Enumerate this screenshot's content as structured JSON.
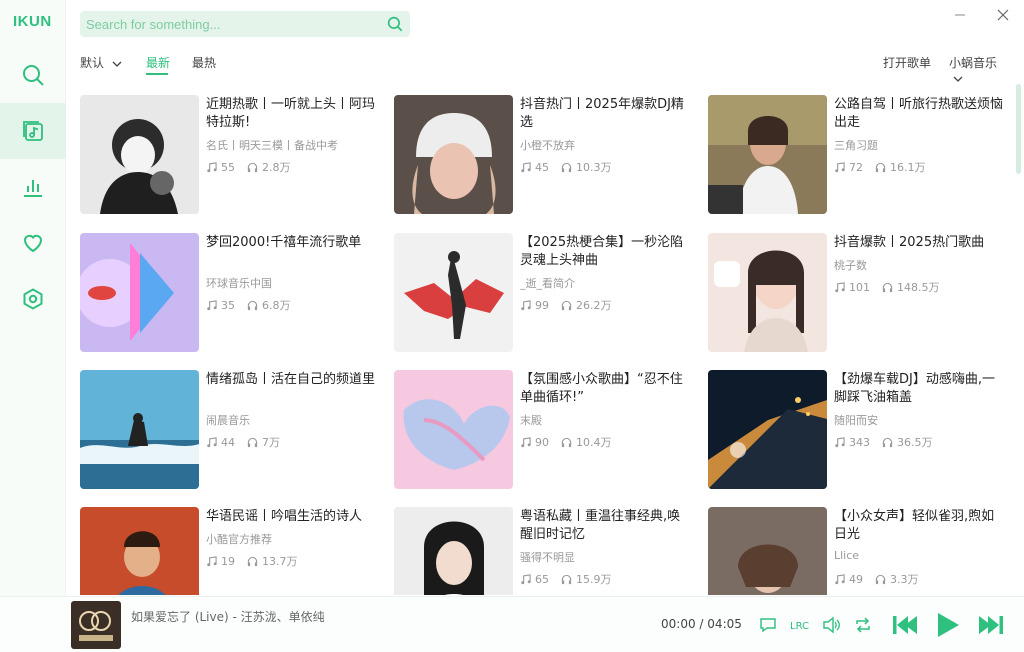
{
  "app": {
    "logo": "IKUN"
  },
  "search": {
    "placeholder": "Search for something..."
  },
  "colors": {
    "accent": "#2fbf7f",
    "accent_light": "#e4f4ea"
  },
  "sidebar": {
    "items": [
      {
        "name": "search",
        "icon": "search-icon",
        "active": false
      },
      {
        "name": "library",
        "icon": "music-library-icon",
        "active": true
      },
      {
        "name": "charts",
        "icon": "bar-chart-icon",
        "active": false
      },
      {
        "name": "favorites",
        "icon": "heart-icon",
        "active": false
      },
      {
        "name": "settings",
        "icon": "settings-icon",
        "active": false
      }
    ]
  },
  "filters": {
    "sort_label": "默认",
    "tab_new": "最新",
    "tab_hot": "最热",
    "open_playlist": "打开歌单",
    "source": "小蜗音乐"
  },
  "playlists": [
    {
      "title": "近期热歌丨一听就上头丨阿玛特拉斯!",
      "author": "名氏丨明天三模丨备战中考",
      "songs": "55",
      "plays": "2.8万"
    },
    {
      "title": "抖音热门丨2025年爆款DJ精选",
      "author": "小橙不放弃",
      "songs": "45",
      "plays": "10.3万"
    },
    {
      "title": "公路自驾丨听旅行热歌送烦恼出走",
      "author": "三角习题",
      "songs": "72",
      "plays": "16.1万"
    },
    {
      "title": "梦回2000!千禧年流行歌单",
      "author": "环球音乐中国",
      "songs": "35",
      "plays": "6.8万"
    },
    {
      "title": "【2025热梗合集】一秒沦陷灵魂上头神曲",
      "author": "_逝_看简介",
      "songs": "99",
      "plays": "26.2万"
    },
    {
      "title": "抖音爆款丨2025热门歌曲",
      "author": "桃子数",
      "songs": "101",
      "plays": "148.5万"
    },
    {
      "title": "情绪孤岛丨活在自己的频道里",
      "author": "闹晨音乐",
      "songs": "44",
      "plays": "7万"
    },
    {
      "title": "【氛围感小众歌曲】“忍不住单曲循环!”",
      "author": "末殿",
      "songs": "90",
      "plays": "10.4万"
    },
    {
      "title": "【劲爆车载DJ】动感嗨曲,一脚踩飞油箱盖",
      "author": "随阳而安",
      "songs": "343",
      "plays": "36.5万"
    },
    {
      "title": "华语民谣丨吟唱生活的诗人",
      "author": "小酷官方推荐",
      "songs": "19",
      "plays": "13.7万"
    },
    {
      "title": "粤语私藏丨重温往事经典,唤醒旧时记忆",
      "author": "骚得不明显",
      "songs": "65",
      "plays": "15.9万"
    },
    {
      "title": "【小众女声】轻似雀羽,煦如日光",
      "author": "Llice",
      "songs": "49",
      "plays": "3.3万"
    }
  ],
  "player": {
    "song": "如果爱忘了 (Live) - 汪苏泷、单依纯",
    "current_time": "00:00",
    "separator": "/",
    "duration": "04:05"
  }
}
